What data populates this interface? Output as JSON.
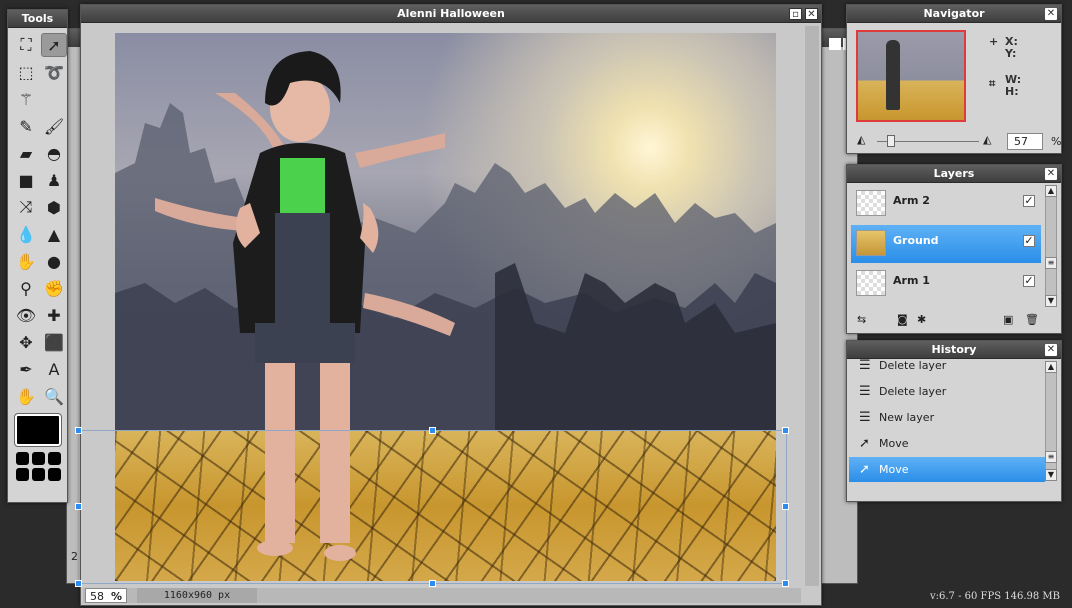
{
  "tools_panel": {
    "title": "Tools",
    "tools": [
      {
        "icon": "crop-icon",
        "glyph": "⛶"
      },
      {
        "icon": "move-icon",
        "glyph": "➚",
        "active": true
      },
      {
        "icon": "marquee-icon",
        "glyph": "⬚"
      },
      {
        "icon": "lasso-icon",
        "glyph": "➰"
      },
      {
        "icon": "magic-wand-icon",
        "glyph": "⚚"
      },
      {
        "icon": "blank-icon",
        "glyph": ""
      },
      {
        "icon": "pencil-icon",
        "glyph": "✎"
      },
      {
        "icon": "brush-icon",
        "glyph": "🖌"
      },
      {
        "icon": "eraser-icon",
        "glyph": "▰"
      },
      {
        "icon": "paint-bucket-icon",
        "glyph": "◓"
      },
      {
        "icon": "gradient-icon",
        "glyph": "■"
      },
      {
        "icon": "clone-stamp-icon",
        "glyph": "♟"
      },
      {
        "icon": "color-replace-icon",
        "glyph": "⤨"
      },
      {
        "icon": "drawing-icon",
        "glyph": "⬢"
      },
      {
        "icon": "blur-icon",
        "glyph": "💧"
      },
      {
        "icon": "sharpen-icon",
        "glyph": "▲"
      },
      {
        "icon": "smudge-icon",
        "glyph": "✋"
      },
      {
        "icon": "sponge-icon",
        "glyph": "●"
      },
      {
        "icon": "dodge-icon",
        "glyph": "⚲"
      },
      {
        "icon": "burn-icon",
        "glyph": "✊"
      },
      {
        "icon": "red-eye-icon",
        "glyph": "👁"
      },
      {
        "icon": "spot-heal-icon",
        "glyph": "✚"
      },
      {
        "icon": "bloat-icon",
        "glyph": "✥"
      },
      {
        "icon": "pinch-icon",
        "glyph": "⬛"
      },
      {
        "icon": "color-picker-icon",
        "glyph": "✒"
      },
      {
        "icon": "type-icon",
        "glyph": "A"
      },
      {
        "icon": "hand-icon",
        "glyph": "✋"
      },
      {
        "icon": "zoom-icon",
        "glyph": "🔍"
      }
    ],
    "primary_color": "#000000"
  },
  "main_window": {
    "title": "Alenni Halloween",
    "zoom_value": "58",
    "zoom_unit": "%",
    "dimensions": "1160x960 px"
  },
  "background_window": {
    "number": "2"
  },
  "navigator": {
    "title": "Navigator",
    "x_label": "X:",
    "y_label": "Y:",
    "w_label": "W:",
    "h_label": "H:",
    "zoom_value": "57",
    "zoom_unit": "%"
  },
  "layers": {
    "title": "Layers",
    "items": [
      {
        "name": "Arm 2",
        "visible": true,
        "selected": false
      },
      {
        "name": "Ground",
        "visible": true,
        "selected": true
      },
      {
        "name": "Arm 1",
        "visible": true,
        "selected": false
      }
    ]
  },
  "history": {
    "title": "History",
    "items": [
      {
        "label": "Delete layer",
        "icon": "document-icon",
        "selected": false
      },
      {
        "label": "Delete layer",
        "icon": "document-icon",
        "selected": false
      },
      {
        "label": "New layer",
        "icon": "document-icon",
        "selected": false
      },
      {
        "label": "Move",
        "icon": "move-icon",
        "selected": false
      },
      {
        "label": "Move",
        "icon": "move-icon",
        "selected": true
      }
    ]
  },
  "status": {
    "fps_text": "v:6.7 - 60 FPS 146.98 MB"
  },
  "colors": {
    "selection_blue": "#2a8ee8",
    "panel_bg": "#d4d4d4",
    "title_bar": "#3e3e3e",
    "desktop": "#2b2b2b"
  }
}
